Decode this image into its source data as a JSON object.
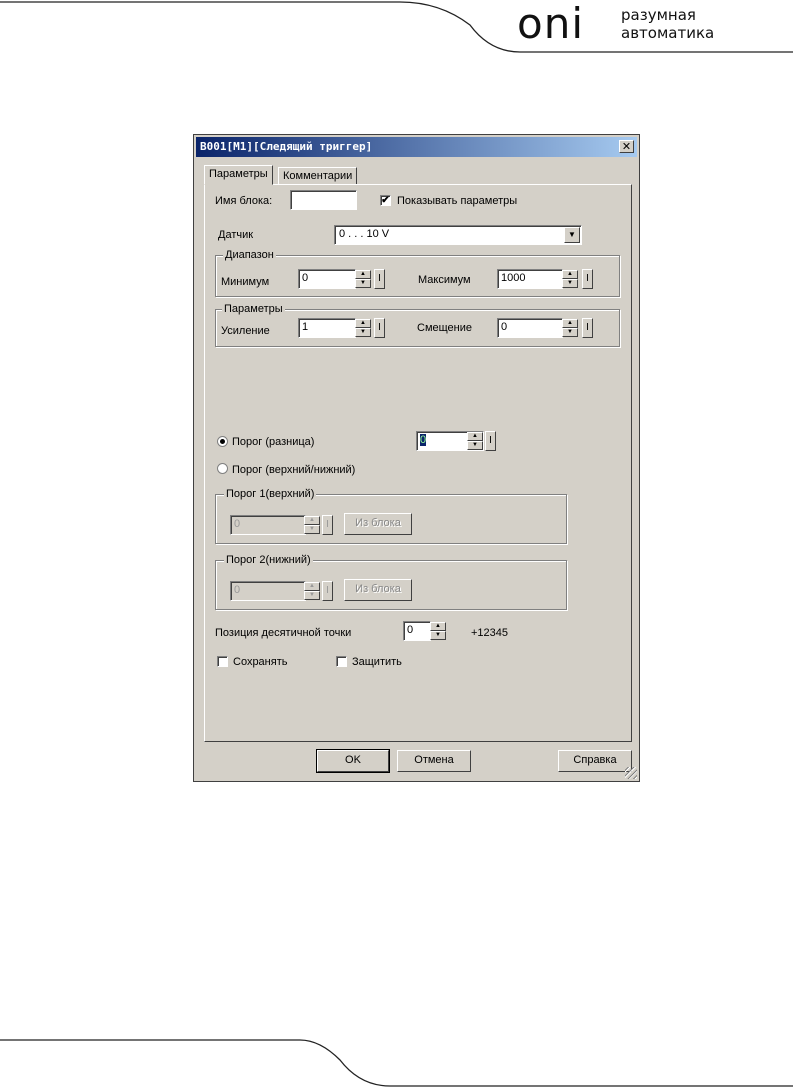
{
  "brand": {
    "logo": "oni",
    "tagline_line1": "разумная",
    "tagline_line2": "автоматика"
  },
  "dialog": {
    "title": "B001[M1][Следящий триггер]",
    "close_symbol": "✕",
    "tabs": [
      {
        "label": "Параметры"
      },
      {
        "label": "Комментарии"
      }
    ],
    "block_name": {
      "label": "Имя блока:",
      "value": ""
    },
    "show_params": {
      "label": "Показывать параметры",
      "checked": true,
      "mark": "✔"
    },
    "sensor": {
      "label": "Датчик",
      "value": "0 . . . 10 V",
      "arrow": "▼"
    },
    "range": {
      "legend": "Диапазон",
      "min": {
        "label": "Минимум",
        "value": "0"
      },
      "max": {
        "label": "Максимум",
        "value": "1000"
      }
    },
    "params": {
      "legend": "Параметры",
      "gain": {
        "label": "Усиление",
        "value": "1"
      },
      "offset": {
        "label": "Смещение",
        "value": "0"
      }
    },
    "threshold_diff": {
      "label": "Порог (разница)",
      "value": "0",
      "selected": true
    },
    "threshold_upper_lower": {
      "label": "Порог (верхний/нижний)",
      "selected": false
    },
    "threshold1": {
      "legend": "Порог 1(верхний)",
      "value": "0",
      "from_block": "Из блока"
    },
    "threshold2": {
      "legend": "Порог 2(нижний)",
      "value": "0",
      "from_block": "Из блока"
    },
    "decimal": {
      "label": "Позиция десятичной точки",
      "value": "0",
      "preview": "+12345"
    },
    "save": {
      "label": "Сохранять",
      "checked": false
    },
    "protect": {
      "label": "Защитить",
      "checked": false
    },
    "buttons": {
      "ok": "OK",
      "cancel": "Отмена",
      "help": "Справка"
    },
    "spin_up": "▲",
    "spin_down": "▼",
    "input_btn": "I"
  }
}
